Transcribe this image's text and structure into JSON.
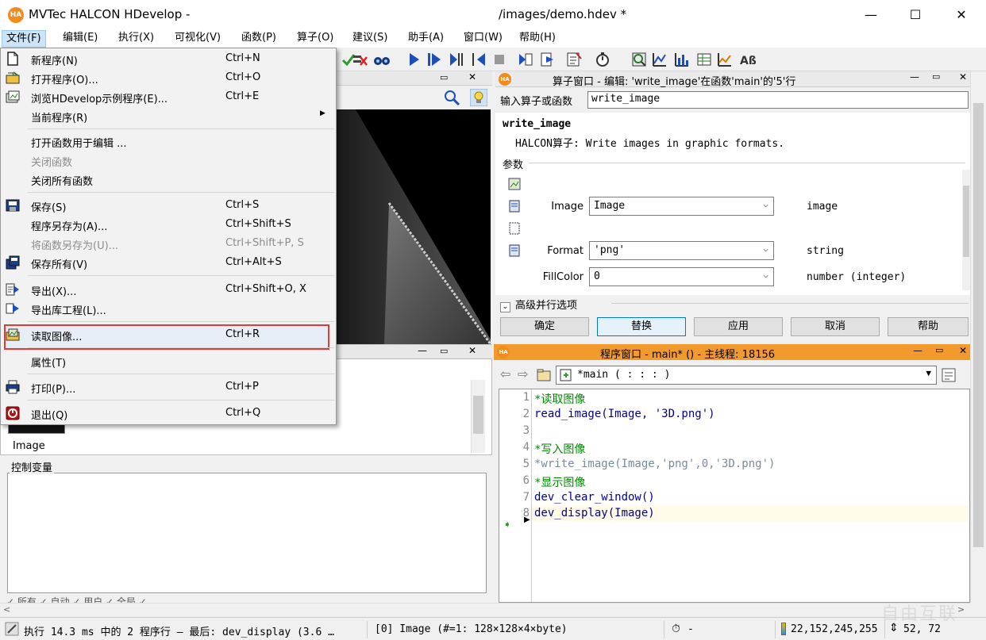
{
  "window": {
    "title": "MVTec HALCON HDevelop -",
    "title_path": "/images/demo.hdev *",
    "minimize": "—",
    "maximize": "☐",
    "close": "✕"
  },
  "menubar": [
    {
      "label": "文件(F)"
    },
    {
      "label": "编辑(E)"
    },
    {
      "label": "执行(X)"
    },
    {
      "label": "可视化(V)"
    },
    {
      "label": "函数(P)"
    },
    {
      "label": "算子(O)"
    },
    {
      "label": "建议(S)"
    },
    {
      "label": "助手(A)"
    },
    {
      "label": "窗口(W)"
    },
    {
      "label": "帮助(H)"
    }
  ],
  "file_menu": {
    "items": [
      {
        "label": "新程序(N)",
        "shortcut": "Ctrl+N",
        "icon": "new-file-icon"
      },
      {
        "label": "打开程序(O)...",
        "shortcut": "Ctrl+O",
        "icon": "open-folder-icon"
      },
      {
        "label": "浏览HDevelop示例程序(E)...",
        "shortcut": "Ctrl+E",
        "icon": "browse-examples-icon"
      },
      {
        "label": "当前程序(R)",
        "shortcut": "",
        "icon": ""
      },
      {
        "label": "打开函数用于编辑 ...",
        "shortcut": "",
        "icon": ""
      },
      {
        "label": "关闭函数",
        "shortcut": "",
        "icon": ""
      },
      {
        "label": "关闭所有函数",
        "shortcut": "",
        "icon": ""
      },
      {
        "label": "保存(S)",
        "shortcut": "Ctrl+S",
        "icon": "save-icon"
      },
      {
        "label": "程序另存为(A)...",
        "shortcut": "Ctrl+Shift+S",
        "icon": ""
      },
      {
        "label": "将函数另存为(U)...",
        "shortcut": "Ctrl+Shift+P, S",
        "icon": ""
      },
      {
        "label": "保存所有(V)",
        "shortcut": "Ctrl+Alt+S",
        "icon": "save-all-icon"
      },
      {
        "label": "导出(X)...",
        "shortcut": "Ctrl+Shift+O, X",
        "icon": "export-icon"
      },
      {
        "label": "导出库工程(L)...",
        "shortcut": "",
        "icon": "export-library-icon"
      },
      {
        "label": "读取图像...",
        "shortcut": "Ctrl+R",
        "icon": "read-image-icon"
      },
      {
        "label": "属性(T)",
        "shortcut": "",
        "icon": ""
      },
      {
        "label": "打印(P)...",
        "shortcut": "Ctrl+P",
        "icon": "print-icon"
      },
      {
        "label": "退出(Q)",
        "shortcut": "Ctrl+Q",
        "icon": "exit-icon"
      }
    ]
  },
  "operator_window": {
    "title": "算子窗口 - 编辑: 'write_image'在函数'main'的'5'行",
    "input_label": "输入算子或函数",
    "input_value": "write_image",
    "op_name": "write_image",
    "op_desc": "HALCON算子: Write images in graphic formats.",
    "params_label": "参数",
    "params": [
      {
        "name": "Image",
        "value": "Image",
        "type": "image"
      },
      {
        "name": "Format",
        "value": "'png'",
        "type": "string"
      },
      {
        "name": "FillColor",
        "value": "0",
        "type": "number (integer)"
      }
    ],
    "advanced_label": "高级并行选项",
    "buttons": [
      "确定",
      "替换",
      "应用",
      "取消",
      "帮助"
    ]
  },
  "program_window": {
    "title": "程序窗口 - main* () - 主线程: 18156",
    "combo_value": "*main ( : : : )",
    "lines": [
      {
        "n": "1",
        "text": "*读取图像",
        "kind": "comment"
      },
      {
        "n": "2",
        "text": "read_image(Image, '3D.png')",
        "kind": "op"
      },
      {
        "n": "3",
        "text": "",
        "kind": "op"
      },
      {
        "n": "4",
        "text": "*写入图像",
        "kind": "comment"
      },
      {
        "n": "5",
        "text": "*write_image(Image,'png',0,'3D.png')",
        "kind": "disabled"
      },
      {
        "n": "6",
        "text": "*显示图像",
        "kind": "comment"
      },
      {
        "n": "7",
        "text": "dev_clear_window()",
        "kind": "op"
      },
      {
        "n": "8",
        "text": "dev_display(Image)",
        "kind": "op"
      }
    ]
  },
  "variable_window": {
    "thumb_label": "Image",
    "control_label": "控制变量",
    "tabs_text": "✓ 所有  ✓ 自动  ✓ 用户  ✓ 全局  ✓"
  },
  "statusbar": {
    "exec": "执行 14.3 ms 中的 2 程序行 — 最后: dev_display (3.6 …",
    "image_info": "[0] Image (#=1: 128×128×4×byte)",
    "timer": "-",
    "color": "22,152,245,255",
    "coords": "52,  72"
  },
  "watermark": "自由互联"
}
